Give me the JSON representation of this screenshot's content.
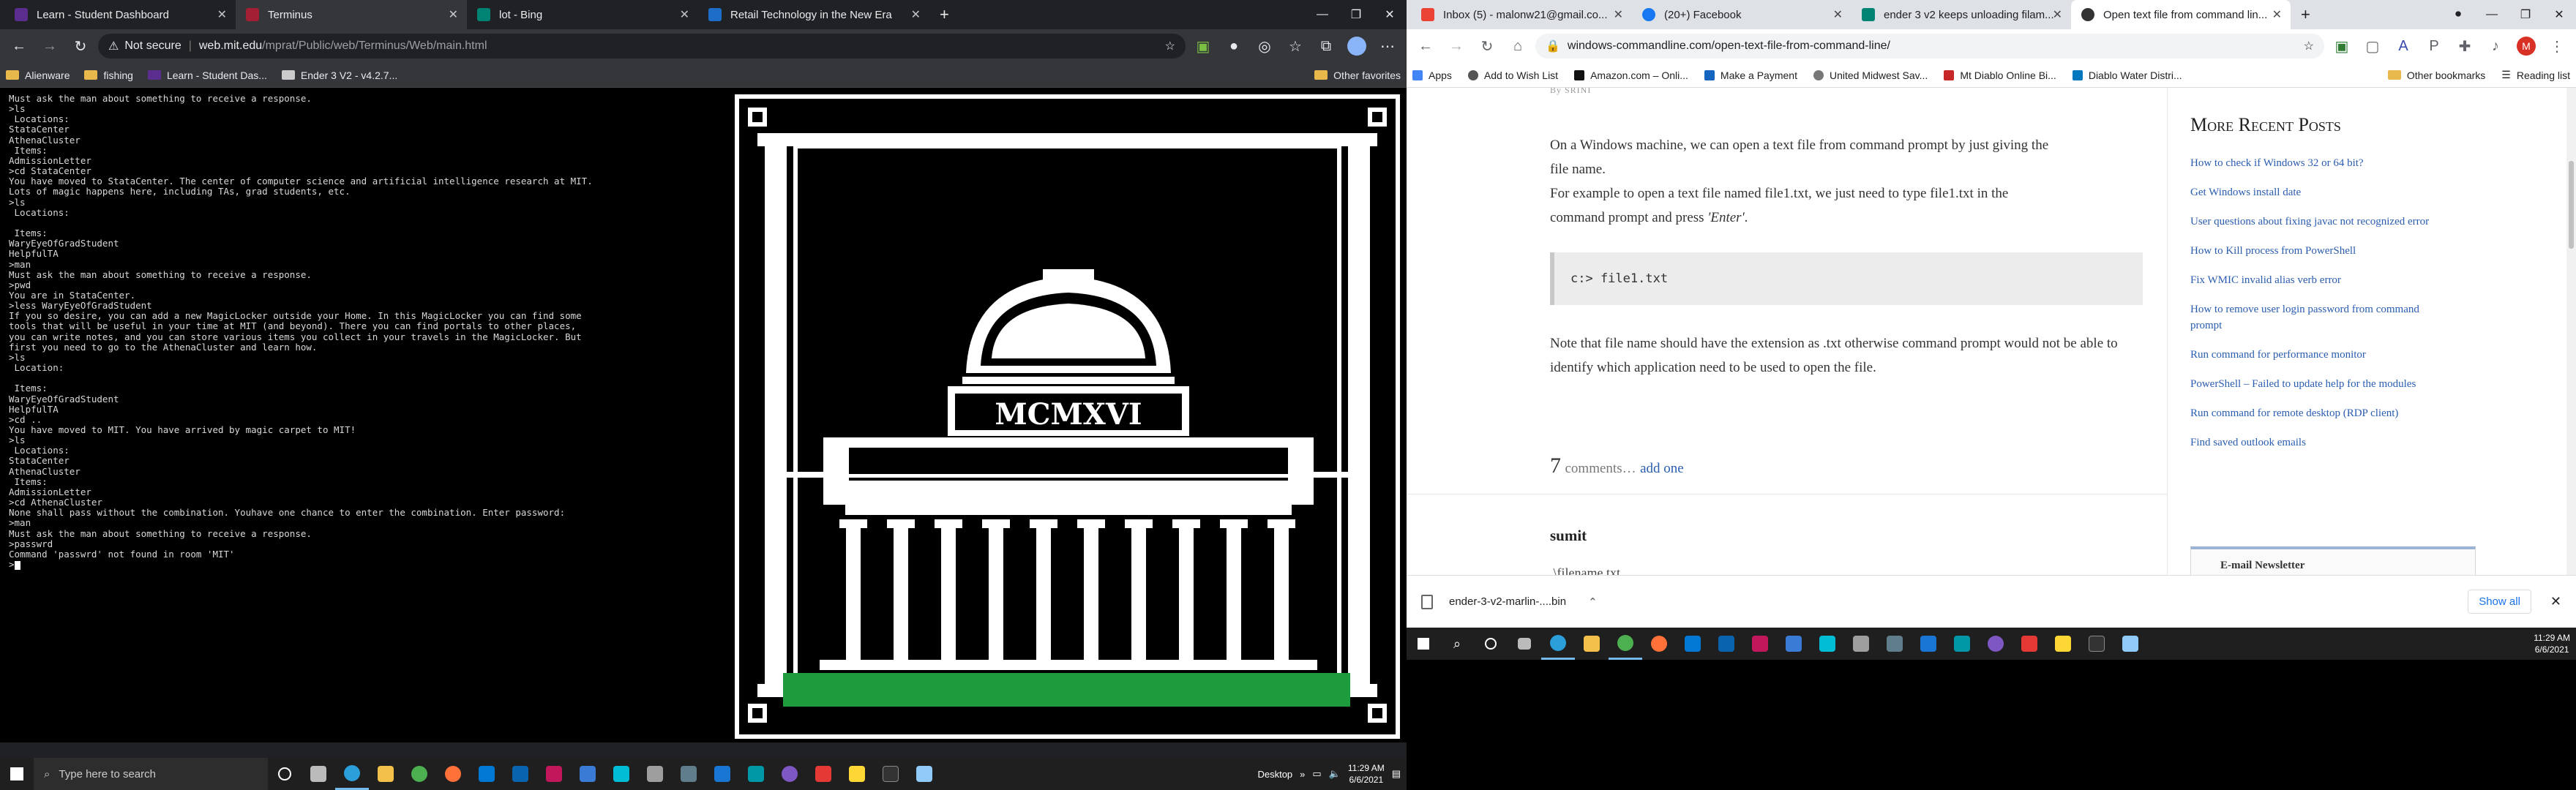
{
  "left_browser": {
    "tabs": [
      {
        "title": "Learn - Student Dashboard",
        "icon": "learn-icon",
        "active": false
      },
      {
        "title": "Terminus",
        "icon": "mit-icon",
        "active": true
      },
      {
        "title": "lot - Bing",
        "icon": "bing-icon",
        "active": false
      },
      {
        "title": "Retail Technology in the New Era",
        "icon": "retail-icon",
        "active": false
      }
    ],
    "new_tab": "+",
    "security": "Not secure",
    "url_host": "web.mit.edu",
    "url_path": "/mprat/Public/web/Terminus/Web/main.html",
    "bookmarks": [
      "Alienware",
      "fishing",
      "Learn - Student Das...",
      "Ender 3 V2 - v4.2.7..."
    ],
    "other_favorites": "Other favorites",
    "window_controls": [
      "—",
      "❐",
      "✕"
    ]
  },
  "terminal": {
    "lines": [
      "Must ask the man about something to receive a response.",
      ">ls",
      " Locations:",
      "StataCenter",
      "AthenaCluster",
      " Items:",
      "AdmissionLetter",
      ">cd StataCenter",
      "You have moved to StataCenter. The center of computer science and artificial intelligence research at MIT.",
      "Lots of magic happens here, including TAs, grad students, etc.",
      ">ls",
      " Locations:",
      "",
      " Items:",
      "WaryEyeOfGradStudent",
      "HelpfulTA",
      ">man",
      "Must ask the man about something to receive a response.",
      ">pwd",
      "You are in StataCenter.",
      ">less WaryEyeOfGradStudent",
      "If you so desire, you can add a new MagicLocker outside your Home. In this MagicLocker you can find some",
      "tools that will be useful in your time at MIT (and beyond). There you can find portals to other places,",
      "you can write notes, and you can store various items you collect in your travels in the MagicLocker. But",
      "first you need to go to the AthenaCluster and learn how.",
      ">ls",
      " Location:",
      "",
      " Items:",
      "WaryEyeOfGradStudent",
      "HelpfulTA",
      ">cd ..",
      "You have moved to MIT. You have arrived by magic carpet to MIT!",
      ">ls",
      " Locations:",
      "StataCenter",
      "AthenaCluster",
      " Items:",
      "AdmissionLetter",
      ">cd AthenaCluster",
      "None shall pass without the combination. Youhave one chance to enter the combination. Enter password:",
      ">man",
      "Must ask the man about something to receive a response.",
      ">passwrd",
      "Command 'passwrd' not found in room 'MIT'",
      ">"
    ],
    "art_inscription": "MCMXVI"
  },
  "left_taskbar": {
    "search_placeholder": "Type here to search",
    "tray_label": "Desktop",
    "time": "11:29 AM",
    "date": "6/6/2021"
  },
  "right_browser": {
    "tabs": [
      {
        "title": "Inbox (5) - malonw21@gmail.co...",
        "icon": "gmail-icon",
        "active": false
      },
      {
        "title": "(20+) Facebook",
        "icon": "facebook-icon",
        "active": false
      },
      {
        "title": "ender 3 v2 keeps unloading filam...",
        "icon": "bing-icon",
        "active": false
      },
      {
        "title": "Open text file from command lin...",
        "icon": "page-icon",
        "active": true
      }
    ],
    "new_tab": "+",
    "url": "windows-commandline.com/open-text-file-from-command-line/",
    "bookmarks": [
      "Apps",
      "Add to Wish List",
      "Amazon.com – Onli...",
      "Make a Payment",
      "United Midwest Sav...",
      "Mt Diablo Online Bi...",
      "Diablo Water Distri..."
    ],
    "other_bookmarks": "Other bookmarks",
    "reading_list": "Reading list",
    "profile_initial": "M",
    "window_controls": [
      "—",
      "❐",
      "✕"
    ]
  },
  "article": {
    "byline": "By SRINI",
    "para1": "On  a Windows machine, we can open a text file from command prompt by just giving the file name.",
    "para2_a": "For example to open a text file named file1.txt, we just need to type file1.txt in the command prompt and press ",
    "para2_em": "'Enter'",
    "para2_b": ".",
    "code": "c:> file1.txt",
    "para3": "Note that file name should have the extension as .txt otherwise command prompt would not be able to identify which application need to be used to open the file.",
    "comments_count": "7",
    "comments_text": "comments…",
    "add_one": "add one",
    "commenter": "sumit",
    "comment_snippet": ".\\filename.txt"
  },
  "sidebar": {
    "heading": "More Recent Posts",
    "links": [
      "How to check if Windows 32 or 64 bit?",
      "Get Windows install date",
      "User questions about fixing javac not recognized error",
      "How to Kill process from PowerShell",
      "Fix WMIC invalid alias verb error",
      "How to remove user login password from command prompt",
      "Run command for performance monitor",
      "PowerShell – Failed to update help for the modules",
      "Run command for remote desktop (RDP client)",
      "Find saved outlook emails"
    ],
    "newsletter": "E-mail Newsletter"
  },
  "downloads": {
    "file": "ender-3-v2-marlin-....bin",
    "show_all": "Show all"
  },
  "right_taskbar": {
    "time": "11:29 AM",
    "date": "6/6/2021"
  }
}
